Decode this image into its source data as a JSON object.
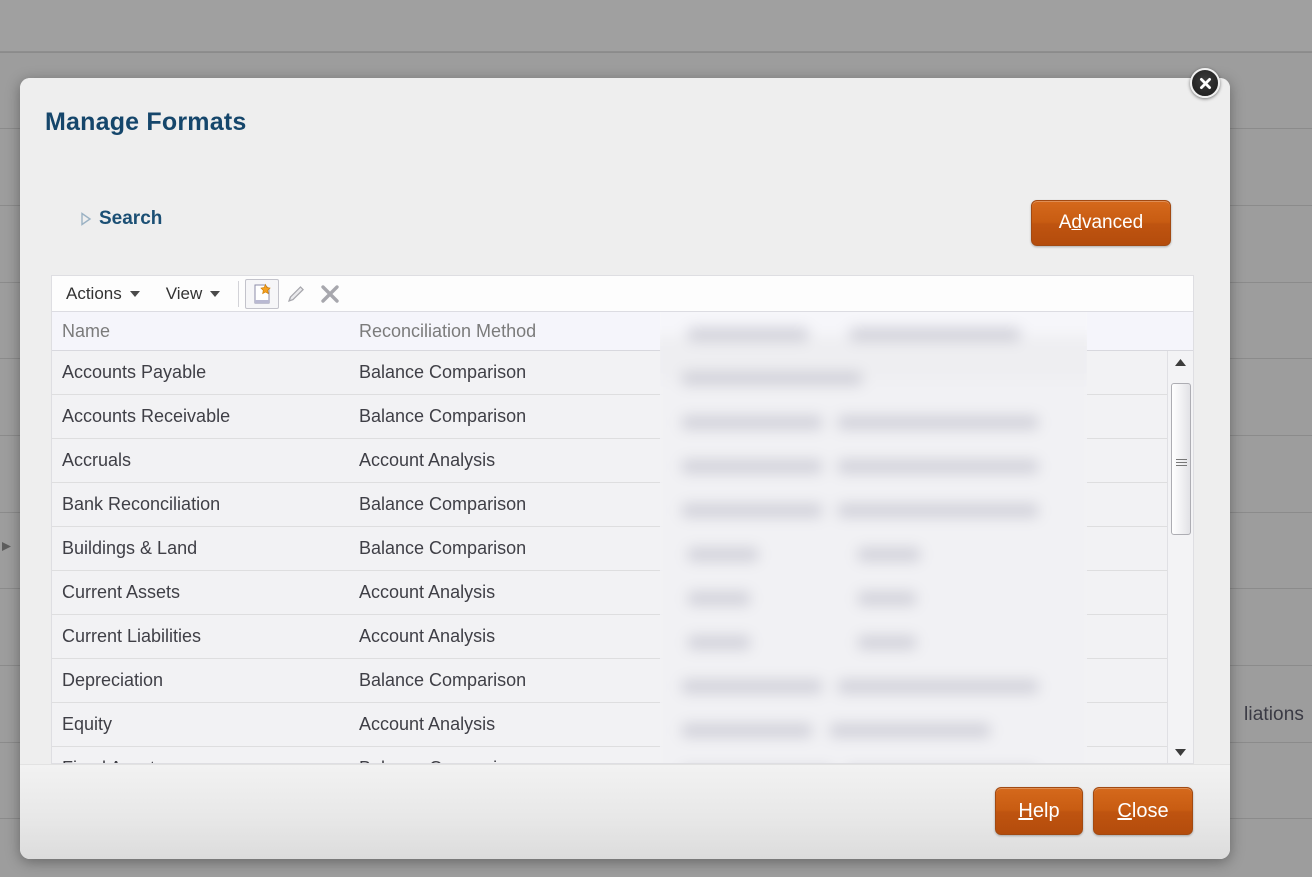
{
  "background": {
    "right_text": "liations",
    "row_separator_tops": [
      52,
      128,
      205,
      282,
      358,
      435,
      512,
      588,
      665,
      742,
      818
    ],
    "left_glyph": "arrow-glyph"
  },
  "dialog": {
    "title": "Manage Formats",
    "close_icon": "close-icon",
    "search": {
      "label": "Search",
      "expanded": false,
      "disclosure_icon": "triangle-right-icon"
    },
    "advanced_button": {
      "label": "Advanced",
      "accesskey_prefix": "A",
      "accesskey_char": "d",
      "accesskey_suffix": "vanced",
      "color": "#c25a12"
    },
    "toolbar": {
      "actions_label": "Actions",
      "view_label": "View",
      "icons": [
        {
          "name": "new-document-icon",
          "enabled": true
        },
        {
          "name": "edit-pencil-icon",
          "enabled": false
        },
        {
          "name": "delete-x-icon",
          "enabled": false
        }
      ]
    },
    "table": {
      "columns": [
        "Name",
        "Reconciliation Method"
      ],
      "redacted_columns_note": "blurred",
      "rows": [
        {
          "name": "Accounts Payable",
          "method": "Balance Comparison"
        },
        {
          "name": "Accounts Receivable",
          "method": "Balance Comparison"
        },
        {
          "name": "Accruals",
          "method": "Account Analysis"
        },
        {
          "name": "Bank Reconciliation",
          "method": "Balance Comparison"
        },
        {
          "name": "Buildings & Land",
          "method": "Balance Comparison"
        },
        {
          "name": "Current Assets",
          "method": "Account Analysis"
        },
        {
          "name": "Current Liabilities",
          "method": "Account Analysis"
        },
        {
          "name": "Depreciation",
          "method": "Balance Comparison"
        },
        {
          "name": "Equity",
          "method": "Account Analysis"
        },
        {
          "name": "Fixed Assets",
          "method": "Balance Comparison"
        }
      ]
    },
    "scrollbar": {
      "up_icon": "triangle-up-icon",
      "down_icon": "triangle-down-icon",
      "thumb_icon": "scroll-thumb-grip"
    },
    "footer": {
      "help_button": {
        "label": "Help",
        "accesskey_char": "H",
        "accesskey_suffix": "elp"
      },
      "close_button": {
        "label": "Close",
        "accesskey_char": "C",
        "accesskey_suffix": "lose"
      }
    }
  }
}
